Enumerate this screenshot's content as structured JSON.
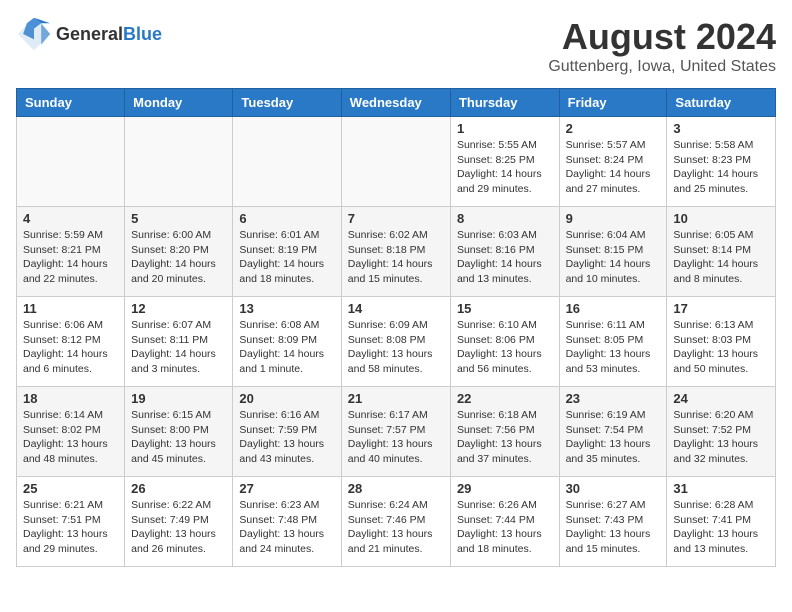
{
  "header": {
    "logo_general": "General",
    "logo_blue": "Blue",
    "month_year": "August 2024",
    "location": "Guttenberg, Iowa, United States"
  },
  "weekdays": [
    "Sunday",
    "Monday",
    "Tuesday",
    "Wednesday",
    "Thursday",
    "Friday",
    "Saturday"
  ],
  "weeks": [
    [
      {
        "day": "",
        "info": ""
      },
      {
        "day": "",
        "info": ""
      },
      {
        "day": "",
        "info": ""
      },
      {
        "day": "",
        "info": ""
      },
      {
        "day": "1",
        "info": "Sunrise: 5:55 AM\nSunset: 8:25 PM\nDaylight: 14 hours and 29 minutes."
      },
      {
        "day": "2",
        "info": "Sunrise: 5:57 AM\nSunset: 8:24 PM\nDaylight: 14 hours and 27 minutes."
      },
      {
        "day": "3",
        "info": "Sunrise: 5:58 AM\nSunset: 8:23 PM\nDaylight: 14 hours and 25 minutes."
      }
    ],
    [
      {
        "day": "4",
        "info": "Sunrise: 5:59 AM\nSunset: 8:21 PM\nDaylight: 14 hours and 22 minutes."
      },
      {
        "day": "5",
        "info": "Sunrise: 6:00 AM\nSunset: 8:20 PM\nDaylight: 14 hours and 20 minutes."
      },
      {
        "day": "6",
        "info": "Sunrise: 6:01 AM\nSunset: 8:19 PM\nDaylight: 14 hours and 18 minutes."
      },
      {
        "day": "7",
        "info": "Sunrise: 6:02 AM\nSunset: 8:18 PM\nDaylight: 14 hours and 15 minutes."
      },
      {
        "day": "8",
        "info": "Sunrise: 6:03 AM\nSunset: 8:16 PM\nDaylight: 14 hours and 13 minutes."
      },
      {
        "day": "9",
        "info": "Sunrise: 6:04 AM\nSunset: 8:15 PM\nDaylight: 14 hours and 10 minutes."
      },
      {
        "day": "10",
        "info": "Sunrise: 6:05 AM\nSunset: 8:14 PM\nDaylight: 14 hours and 8 minutes."
      }
    ],
    [
      {
        "day": "11",
        "info": "Sunrise: 6:06 AM\nSunset: 8:12 PM\nDaylight: 14 hours and 6 minutes."
      },
      {
        "day": "12",
        "info": "Sunrise: 6:07 AM\nSunset: 8:11 PM\nDaylight: 14 hours and 3 minutes."
      },
      {
        "day": "13",
        "info": "Sunrise: 6:08 AM\nSunset: 8:09 PM\nDaylight: 14 hours and 1 minute."
      },
      {
        "day": "14",
        "info": "Sunrise: 6:09 AM\nSunset: 8:08 PM\nDaylight: 13 hours and 58 minutes."
      },
      {
        "day": "15",
        "info": "Sunrise: 6:10 AM\nSunset: 8:06 PM\nDaylight: 13 hours and 56 minutes."
      },
      {
        "day": "16",
        "info": "Sunrise: 6:11 AM\nSunset: 8:05 PM\nDaylight: 13 hours and 53 minutes."
      },
      {
        "day": "17",
        "info": "Sunrise: 6:13 AM\nSunset: 8:03 PM\nDaylight: 13 hours and 50 minutes."
      }
    ],
    [
      {
        "day": "18",
        "info": "Sunrise: 6:14 AM\nSunset: 8:02 PM\nDaylight: 13 hours and 48 minutes."
      },
      {
        "day": "19",
        "info": "Sunrise: 6:15 AM\nSunset: 8:00 PM\nDaylight: 13 hours and 45 minutes."
      },
      {
        "day": "20",
        "info": "Sunrise: 6:16 AM\nSunset: 7:59 PM\nDaylight: 13 hours and 43 minutes."
      },
      {
        "day": "21",
        "info": "Sunrise: 6:17 AM\nSunset: 7:57 PM\nDaylight: 13 hours and 40 minutes."
      },
      {
        "day": "22",
        "info": "Sunrise: 6:18 AM\nSunset: 7:56 PM\nDaylight: 13 hours and 37 minutes."
      },
      {
        "day": "23",
        "info": "Sunrise: 6:19 AM\nSunset: 7:54 PM\nDaylight: 13 hours and 35 minutes."
      },
      {
        "day": "24",
        "info": "Sunrise: 6:20 AM\nSunset: 7:52 PM\nDaylight: 13 hours and 32 minutes."
      }
    ],
    [
      {
        "day": "25",
        "info": "Sunrise: 6:21 AM\nSunset: 7:51 PM\nDaylight: 13 hours and 29 minutes."
      },
      {
        "day": "26",
        "info": "Sunrise: 6:22 AM\nSunset: 7:49 PM\nDaylight: 13 hours and 26 minutes."
      },
      {
        "day": "27",
        "info": "Sunrise: 6:23 AM\nSunset: 7:48 PM\nDaylight: 13 hours and 24 minutes."
      },
      {
        "day": "28",
        "info": "Sunrise: 6:24 AM\nSunset: 7:46 PM\nDaylight: 13 hours and 21 minutes."
      },
      {
        "day": "29",
        "info": "Sunrise: 6:26 AM\nSunset: 7:44 PM\nDaylight: 13 hours and 18 minutes."
      },
      {
        "day": "30",
        "info": "Sunrise: 6:27 AM\nSunset: 7:43 PM\nDaylight: 13 hours and 15 minutes."
      },
      {
        "day": "31",
        "info": "Sunrise: 6:28 AM\nSunset: 7:41 PM\nDaylight: 13 hours and 13 minutes."
      }
    ]
  ]
}
